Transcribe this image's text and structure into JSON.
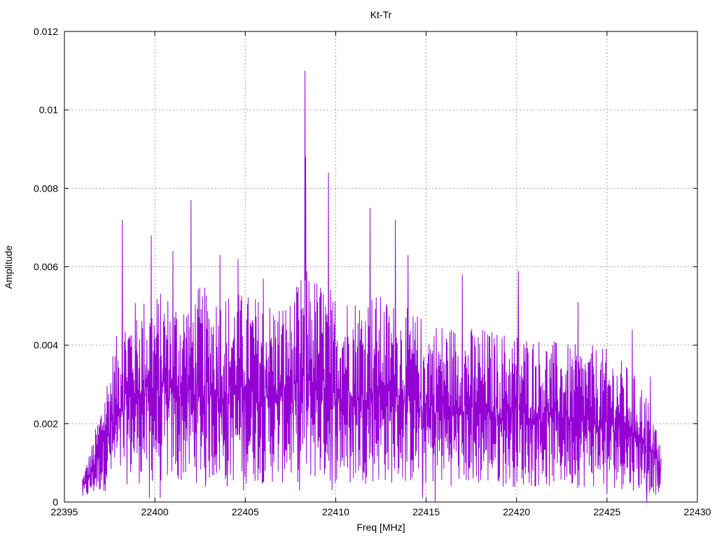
{
  "chart_data": {
    "type": "line",
    "title": "Kt-Tr",
    "xlabel": "Freq [MHz]",
    "ylabel": "Amplitude",
    "xlim": [
      22395,
      22430
    ],
    "ylim": [
      0,
      0.012
    ],
    "x_ticks": [
      "22395",
      "22400",
      "22405",
      "22410",
      "22415",
      "22420",
      "22425",
      "22430"
    ],
    "y_ticks": [
      "0",
      "0.002",
      "0.004",
      "0.006",
      "0.008",
      "0.01",
      "0.012"
    ],
    "grid": true,
    "line_color": "#9400d3",
    "series": [
      {
        "x_start": 22396.0,
        "x_end": 22428.0,
        "envelope": [
          [
            22396.0,
            0.0006
          ],
          [
            22396.6,
            0.0014
          ],
          [
            22397.2,
            0.0026
          ],
          [
            22397.8,
            0.0036
          ],
          [
            22398.5,
            0.0044
          ],
          [
            22399.5,
            0.0046
          ],
          [
            22400.5,
            0.0047
          ],
          [
            22401.5,
            0.0046
          ],
          [
            22402.5,
            0.0048
          ],
          [
            22403.5,
            0.0047
          ],
          [
            22404.5,
            0.0047
          ],
          [
            22405.5,
            0.0046
          ],
          [
            22406.5,
            0.0045
          ],
          [
            22407.5,
            0.0045
          ],
          [
            22408.3,
            0.0052
          ],
          [
            22409.0,
            0.005
          ],
          [
            22410.0,
            0.0047
          ],
          [
            22411.0,
            0.0046
          ],
          [
            22412.0,
            0.0047
          ],
          [
            22413.0,
            0.0045
          ],
          [
            22414.0,
            0.0043
          ],
          [
            22415.0,
            0.0041
          ],
          [
            22416.0,
            0.004
          ],
          [
            22417.0,
            0.0039
          ],
          [
            22418.0,
            0.0039
          ],
          [
            22419.0,
            0.0038
          ],
          [
            22420.0,
            0.0038
          ],
          [
            22421.0,
            0.0037
          ],
          [
            22422.0,
            0.0036
          ],
          [
            22423.0,
            0.0035
          ],
          [
            22424.0,
            0.0035
          ],
          [
            22425.0,
            0.0034
          ],
          [
            22426.0,
            0.0031
          ],
          [
            22427.0,
            0.0026
          ],
          [
            22427.6,
            0.002
          ],
          [
            22428.0,
            0.0012
          ]
        ],
        "peaks": [
          [
            22398.2,
            0.0072
          ],
          [
            22399.8,
            0.0068
          ],
          [
            22401.0,
            0.0064
          ],
          [
            22402.0,
            0.0077
          ],
          [
            22402.8,
            0.0066
          ],
          [
            22403.6,
            0.0063
          ],
          [
            22404.6,
            0.0062
          ],
          [
            22406.0,
            0.0057
          ],
          [
            22408.3,
            0.011
          ],
          [
            22408.35,
            0.0088
          ],
          [
            22409.6,
            0.0084
          ],
          [
            22411.9,
            0.0075
          ],
          [
            22413.3,
            0.0072
          ],
          [
            22414.0,
            0.0063
          ],
          [
            22417.0,
            0.0058
          ],
          [
            22420.1,
            0.0059
          ],
          [
            22423.4,
            0.0051
          ],
          [
            22425.0,
            0.0056
          ],
          [
            22426.4,
            0.0044
          ],
          [
            22427.4,
            0.0032
          ]
        ],
        "dips": [
          [
            22399.7,
            0.0001
          ],
          [
            22400.3,
            0.0001
          ],
          [
            22401.3,
            0.0006
          ],
          [
            22402.8,
            0.0004
          ],
          [
            22404.0,
            0.0004
          ],
          [
            22404.9,
            0.0003
          ],
          [
            22408.0,
            0.0003
          ],
          [
            22409.8,
            0.0003
          ],
          [
            22410.8,
            0.0005
          ],
          [
            22414.8,
            0.0001
          ],
          [
            22415.5,
            0.0
          ],
          [
            22417.6,
            0.0006
          ],
          [
            22420.3,
            0.0006
          ],
          [
            22425.0,
            0.0002
          ],
          [
            22427.2,
            0.0
          ],
          [
            22427.8,
            0.0004
          ]
        ]
      }
    ]
  }
}
